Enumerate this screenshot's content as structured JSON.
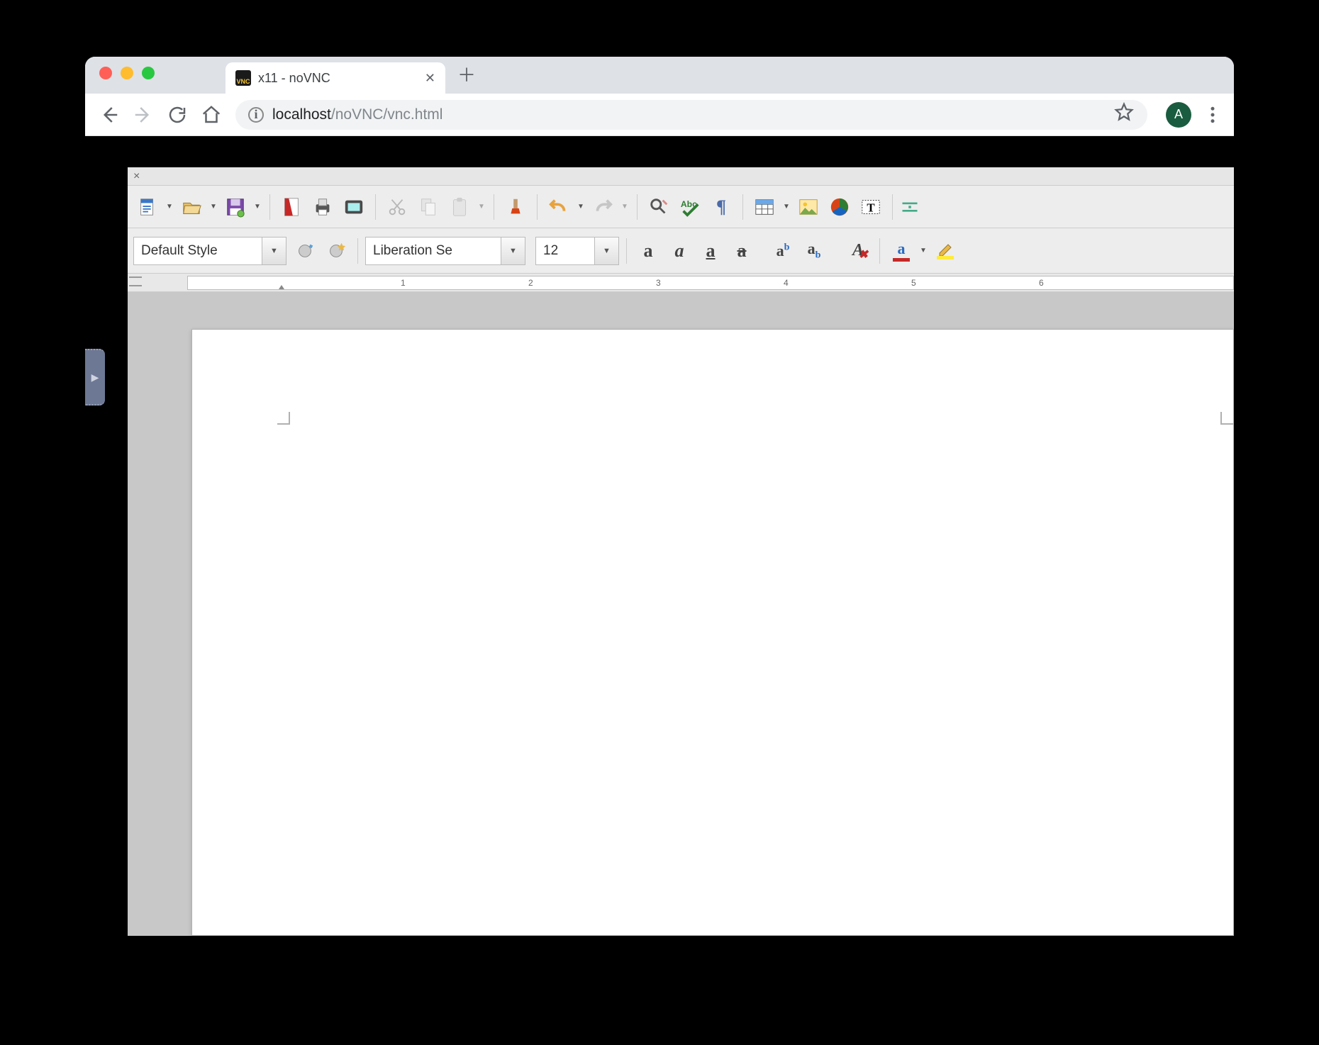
{
  "browser": {
    "tab_title": "x11 - noVNC",
    "url_host": "localhost",
    "url_path": "/noVNC/vnc.html",
    "avatar_initial": "A"
  },
  "libre": {
    "style_combo": "Default Style",
    "font_combo": "Liberation Se",
    "size_combo": "12"
  },
  "ruler": {
    "nums": [
      "1",
      "2",
      "3",
      "4",
      "5",
      "6"
    ]
  }
}
